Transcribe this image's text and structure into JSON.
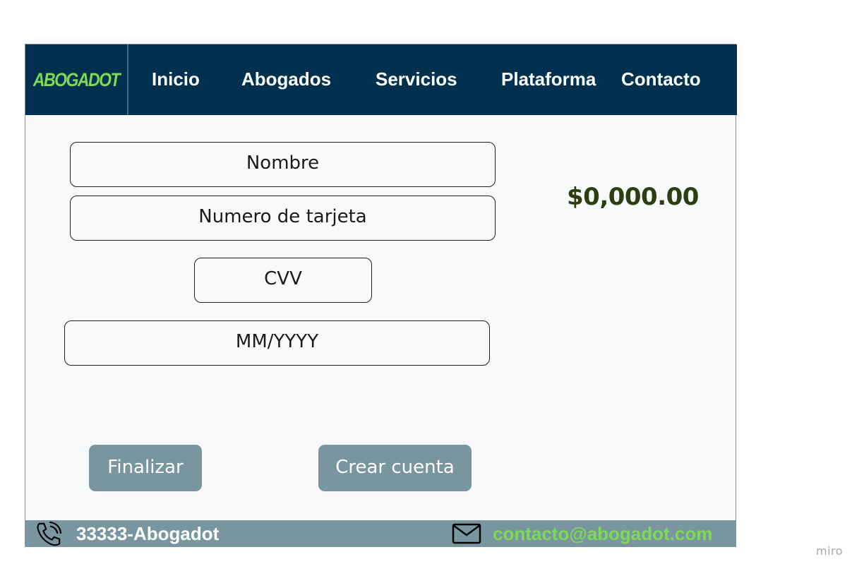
{
  "brand": {
    "logo_text": "ABOGADOT"
  },
  "nav": {
    "items": [
      {
        "label": "Inicio"
      },
      {
        "label": "Abogados"
      },
      {
        "label": "Servicios"
      },
      {
        "label": "Plataforma"
      },
      {
        "label": "Contacto"
      }
    ]
  },
  "form": {
    "name_placeholder": "Nombre",
    "card_number_placeholder": "Numero de tarjeta",
    "cvv_placeholder": "CVV",
    "expiry_placeholder": "MM/YYYY"
  },
  "summary": {
    "price": "$0,000.00"
  },
  "actions": {
    "finish_label": "Finalizar",
    "create_account_label": "Crear cuenta"
  },
  "footer": {
    "phone": "33333-Abogadot",
    "email": "contacto@abogadot.com"
  },
  "watermark": "miro",
  "icons": {
    "phone": "phone-icon",
    "mail": "mail-icon"
  },
  "colors": {
    "navbar_bg": "#023150",
    "brand_green": "#7ed957",
    "button_bg": "#7895a0",
    "footer_bg": "#7895a0",
    "price_text": "#2f3d12"
  }
}
